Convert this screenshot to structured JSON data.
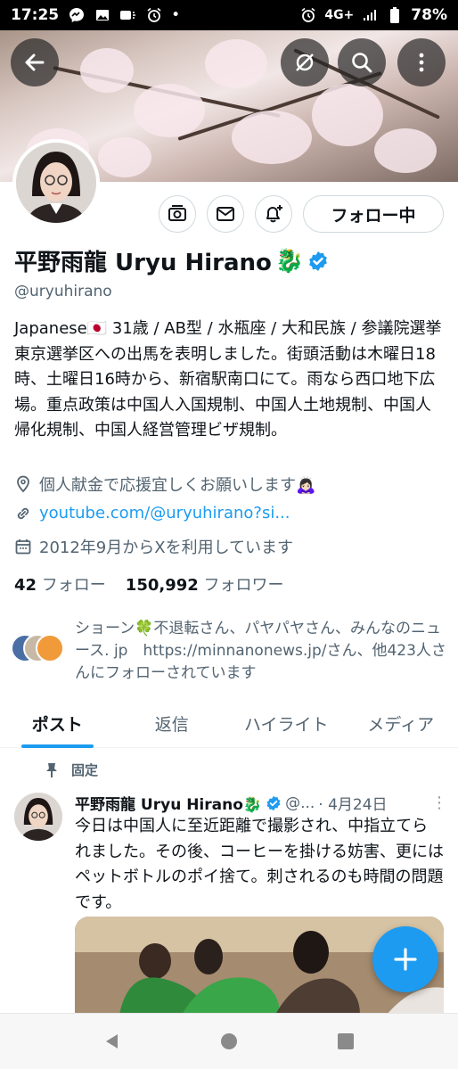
{
  "status_bar": {
    "time": "17:25",
    "network": "4G+",
    "battery": "78%",
    "dot": "•"
  },
  "header": {
    "back_icon": "arrow-left-icon",
    "grok_icon": "grok-icon",
    "search_icon": "search-icon",
    "more_icon": "more-vertical-icon"
  },
  "profile": {
    "name": "平野雨龍 Uryu Hirano",
    "name_emoji": "🐉",
    "verified_color": "#1d9bf0",
    "handle": "@uryuhirano",
    "follow_button": "フォロー中",
    "bio": "Japanese🇯🇵 31歳 / AB型 / 水瓶座 / 大和民族 / 参議院選挙東京選挙区への出馬を表明しました。街頭活動は木曜日18時、土曜日16時から、新宿駅南口にて。雨なら西口地下広場。重点政策は中国人入国規制、中国人土地規制、中国人帰化規制、中国人経営管理ビザ規制。",
    "location": "個人献金で応援宜しくお願いします🙇🏻‍♀️",
    "link": "youtube.com/@uryuhirano?si...",
    "joined": "2012年9月からXを利用しています",
    "following_count": "42",
    "following_label": "フォロー",
    "followers_count": "150,992",
    "followers_label": "フォロワー",
    "followed_by": "ショーン🍀不退転さん、パヤパヤさん、みんなのニュース. jp　https://minnanonews.jp/さん、他423人さんにフォローされています"
  },
  "tabs": [
    {
      "label": "ポスト",
      "active": true
    },
    {
      "label": "返信",
      "active": false
    },
    {
      "label": "ハイライト",
      "active": false
    },
    {
      "label": "メディア",
      "active": false
    }
  ],
  "post": {
    "pinned_label": "固定",
    "author": "平野雨龍 Uryu Hirano🐉",
    "handle_short": "@...",
    "date": "· 4月24日",
    "text": "今日は中国人に至近距離で撮影され、中指立てられました。その後、コーヒーを掛ける妨害、更にはペットボトルのポイ捨て。刺されるのも時間の問題です。"
  },
  "fab_icon": "plus-icon",
  "accent_color": "#1d9bf0"
}
